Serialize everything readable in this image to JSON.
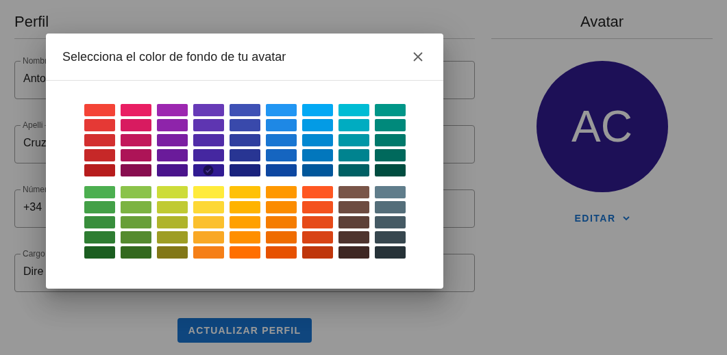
{
  "profile": {
    "title": "Perfil",
    "fields": [
      {
        "label": "Nombr",
        "value": "Anto"
      },
      {
        "label": "Apelli",
        "value": "Cruz"
      },
      {
        "label": "Númer",
        "value": "+34"
      },
      {
        "label": "Cargo",
        "value": "Dire"
      }
    ],
    "submit_button": "ACTUALIZAR PERFIL"
  },
  "avatar": {
    "title": "Avatar",
    "initials": "AC",
    "edit_button": "EDITAR"
  },
  "dialog": {
    "title": "Selecciona el color de fondo de tu avatar",
    "swatch_groups": [
      {
        "columns": [
          [
            {
              "color": "#f44336",
              "selected": false
            },
            {
              "color": "#e53935",
              "selected": false
            },
            {
              "color": "#d32f2f",
              "selected": false
            },
            {
              "color": "#c62828",
              "selected": false
            },
            {
              "color": "#b71c1c",
              "selected": false
            }
          ],
          [
            {
              "color": "#e91e63",
              "selected": false
            },
            {
              "color": "#d81b60",
              "selected": false
            },
            {
              "color": "#c2185b",
              "selected": false
            },
            {
              "color": "#ad1457",
              "selected": false
            },
            {
              "color": "#880e4f",
              "selected": false
            }
          ],
          [
            {
              "color": "#9c27b0",
              "selected": false
            },
            {
              "color": "#8e24aa",
              "selected": false
            },
            {
              "color": "#7b1fa2",
              "selected": false
            },
            {
              "color": "#6a1b9a",
              "selected": false
            },
            {
              "color": "#4a148c",
              "selected": false
            }
          ],
          [
            {
              "color": "#673ab7",
              "selected": false
            },
            {
              "color": "#5e35b1",
              "selected": false
            },
            {
              "color": "#512da8",
              "selected": false
            },
            {
              "color": "#4527a0",
              "selected": false
            },
            {
              "color": "#311b92",
              "selected": true
            }
          ],
          [
            {
              "color": "#3f51b5",
              "selected": false
            },
            {
              "color": "#3949ab",
              "selected": false
            },
            {
              "color": "#303f9f",
              "selected": false
            },
            {
              "color": "#283593",
              "selected": false
            },
            {
              "color": "#1a237e",
              "selected": false
            }
          ],
          [
            {
              "color": "#2196f3",
              "selected": false
            },
            {
              "color": "#1e88e5",
              "selected": false
            },
            {
              "color": "#1976d2",
              "selected": false
            },
            {
              "color": "#1565c0",
              "selected": false
            },
            {
              "color": "#0d47a1",
              "selected": false
            }
          ],
          [
            {
              "color": "#03a9f4",
              "selected": false
            },
            {
              "color": "#039be5",
              "selected": false
            },
            {
              "color": "#0288d1",
              "selected": false
            },
            {
              "color": "#0277bd",
              "selected": false
            },
            {
              "color": "#01579b",
              "selected": false
            }
          ],
          [
            {
              "color": "#00bcd4",
              "selected": false
            },
            {
              "color": "#00acc1",
              "selected": false
            },
            {
              "color": "#0097a7",
              "selected": false
            },
            {
              "color": "#00838f",
              "selected": false
            },
            {
              "color": "#006064",
              "selected": false
            }
          ],
          [
            {
              "color": "#009688",
              "selected": false
            },
            {
              "color": "#00897b",
              "selected": false
            },
            {
              "color": "#00796b",
              "selected": false
            },
            {
              "color": "#00695c",
              "selected": false
            },
            {
              "color": "#004d40",
              "selected": false
            }
          ]
        ]
      },
      {
        "columns": [
          [
            {
              "color": "#4caf50",
              "selected": false
            },
            {
              "color": "#43a047",
              "selected": false
            },
            {
              "color": "#388e3c",
              "selected": false
            },
            {
              "color": "#2e7d32",
              "selected": false
            },
            {
              "color": "#1b5e20",
              "selected": false
            }
          ],
          [
            {
              "color": "#8bc34a",
              "selected": false
            },
            {
              "color": "#7cb342",
              "selected": false
            },
            {
              "color": "#689f38",
              "selected": false
            },
            {
              "color": "#558b2f",
              "selected": false
            },
            {
              "color": "#33691e",
              "selected": false
            }
          ],
          [
            {
              "color": "#cddc39",
              "selected": false
            },
            {
              "color": "#c0ca33",
              "selected": false
            },
            {
              "color": "#afb42b",
              "selected": false
            },
            {
              "color": "#9e9d24",
              "selected": false
            },
            {
              "color": "#827717",
              "selected": false
            }
          ],
          [
            {
              "color": "#ffeb3b",
              "selected": false
            },
            {
              "color": "#fdd835",
              "selected": false
            },
            {
              "color": "#fbc02d",
              "selected": false
            },
            {
              "color": "#f9a825",
              "selected": false
            },
            {
              "color": "#f57f17",
              "selected": false
            }
          ],
          [
            {
              "color": "#ffc107",
              "selected": false
            },
            {
              "color": "#ffb300",
              "selected": false
            },
            {
              "color": "#ffa000",
              "selected": false
            },
            {
              "color": "#ff8f00",
              "selected": false
            },
            {
              "color": "#ff6f00",
              "selected": false
            }
          ],
          [
            {
              "color": "#ff9800",
              "selected": false
            },
            {
              "color": "#fb8c00",
              "selected": false
            },
            {
              "color": "#f57c00",
              "selected": false
            },
            {
              "color": "#ef6c00",
              "selected": false
            },
            {
              "color": "#e65100",
              "selected": false
            }
          ],
          [
            {
              "color": "#ff5722",
              "selected": false
            },
            {
              "color": "#f4511e",
              "selected": false
            },
            {
              "color": "#e64a19",
              "selected": false
            },
            {
              "color": "#d84315",
              "selected": false
            },
            {
              "color": "#bf360c",
              "selected": false
            }
          ],
          [
            {
              "color": "#795548",
              "selected": false
            },
            {
              "color": "#6d4c41",
              "selected": false
            },
            {
              "color": "#5d4037",
              "selected": false
            },
            {
              "color": "#4e342e",
              "selected": false
            },
            {
              "color": "#3e2723",
              "selected": false
            }
          ],
          [
            {
              "color": "#607d8b",
              "selected": false
            },
            {
              "color": "#546e7a",
              "selected": false
            },
            {
              "color": "#455a64",
              "selected": false
            },
            {
              "color": "#37474f",
              "selected": false
            },
            {
              "color": "#263238",
              "selected": false
            }
          ]
        ]
      }
    ]
  }
}
